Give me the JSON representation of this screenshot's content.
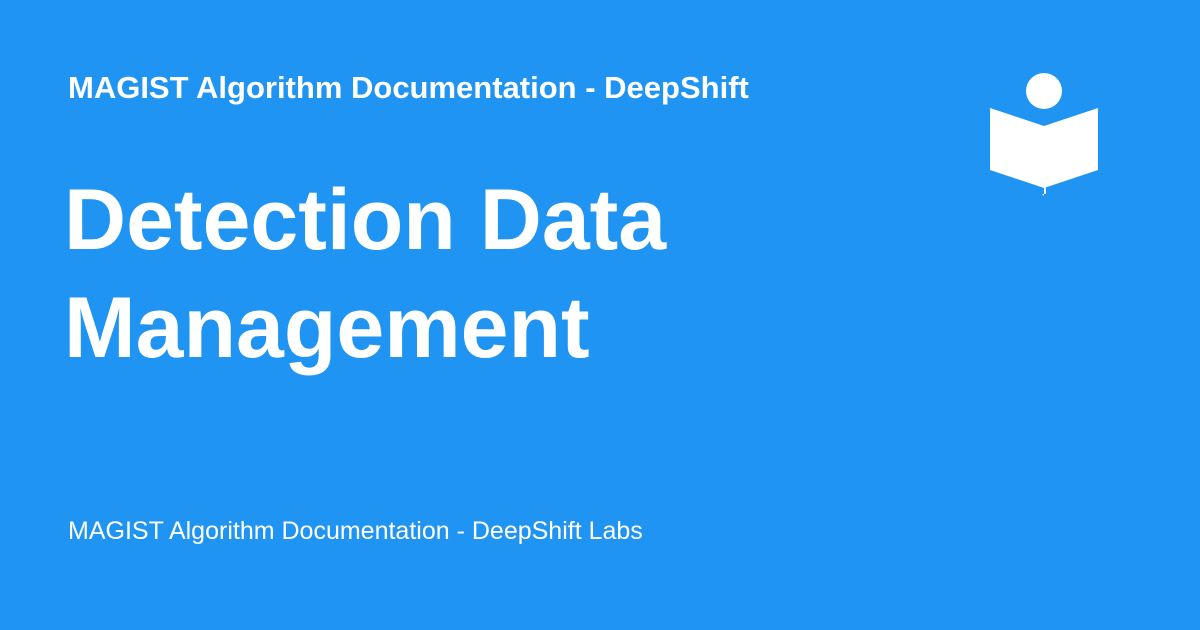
{
  "header": {
    "site_title": "MAGIST Algorithm Documentation - DeepShift"
  },
  "main": {
    "title": "Detection Data Management"
  },
  "footer": {
    "text": "MAGIST Algorithm Documentation - DeepShift Labs"
  },
  "logo": {
    "icon": "reader-book-icon"
  },
  "colors": {
    "background": "#2094f3",
    "text": "#ffffff"
  }
}
